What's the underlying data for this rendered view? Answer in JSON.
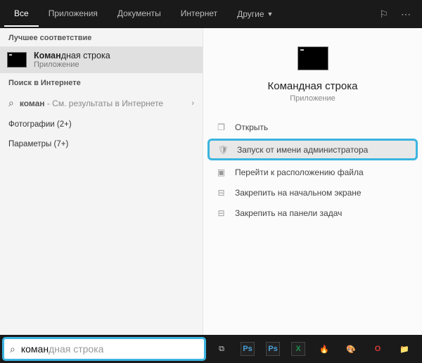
{
  "tabs": {
    "all": "Все",
    "apps": "Приложения",
    "docs": "Документы",
    "web": "Интернет",
    "more": "Другие"
  },
  "sections": {
    "best": "Лучшее соответствие",
    "websearch": "Поиск в Интернете",
    "photos": "Фотографии (2+)",
    "params": "Параметры (7+)"
  },
  "best": {
    "title_bold": "Коман",
    "title_rest": "дная строка",
    "subtitle": "Приложение"
  },
  "web": {
    "query_bold": "коман",
    "hint": " - См. результаты в Интернете"
  },
  "preview": {
    "title": "Командная строка",
    "subtitle": "Приложение"
  },
  "actions": {
    "open": "Открыть",
    "admin": "Запуск от имени администратора",
    "location": "Перейти к расположению файла",
    "pin_start": "Закрепить на начальном экране",
    "pin_taskbar": "Закрепить на панели задач"
  },
  "search": {
    "typed": "коман",
    "ghost": "дная строка",
    "placeholder": "командная строка"
  },
  "taskbar_icons": [
    "Ps",
    "Ps",
    "X",
    "🔥",
    "🎨",
    "O",
    "📁"
  ]
}
